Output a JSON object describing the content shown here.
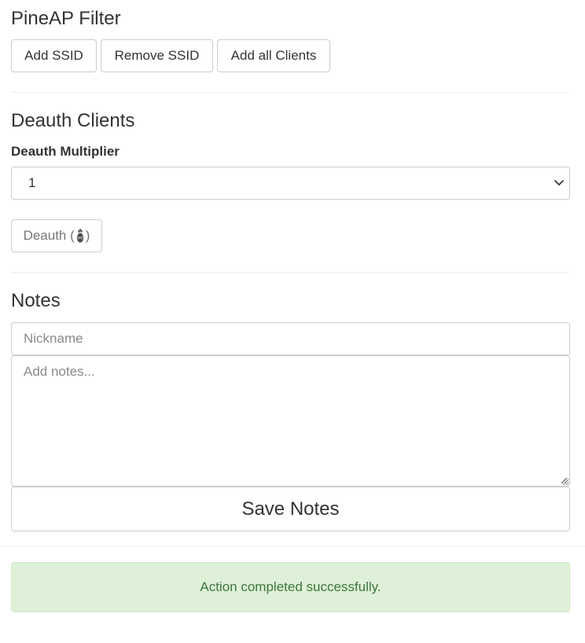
{
  "pineap_filter": {
    "title": "PineAP Filter",
    "buttons": {
      "add_ssid": "Add SSID",
      "remove_ssid": "Remove SSID",
      "add_all_clients": "Add all Clients"
    }
  },
  "deauth": {
    "title": "Deauth Clients",
    "multiplier_label": "Deauth Multiplier",
    "multiplier_value": "1",
    "button_label": "Deauth (",
    "button_suffix": ")",
    "button_icon": "pineapple-icon"
  },
  "notes": {
    "title": "Notes",
    "nickname_placeholder": "Nickname",
    "nickname_value": "",
    "notes_placeholder": "Add notes...",
    "notes_value": "",
    "save_label": "Save Notes"
  },
  "alert": {
    "message": "Action completed successfully.",
    "type": "success"
  },
  "colors": {
    "success_bg": "#dff0d8",
    "success_text": "#3c763d",
    "border": "#cccccc",
    "text": "#333333"
  }
}
